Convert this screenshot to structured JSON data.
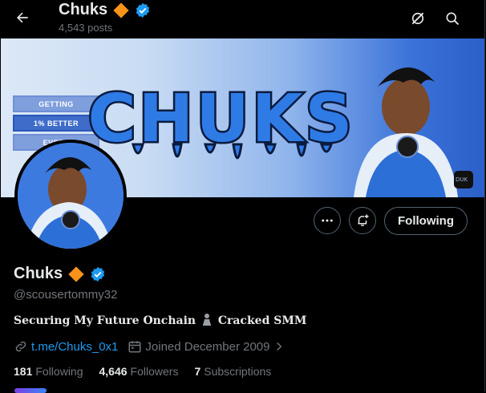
{
  "header": {
    "name": "Chuks",
    "posts_count": "4,543 posts"
  },
  "banner": {
    "pill_lines": [
      "GETTING",
      "1% BETTER",
      "EVERY"
    ],
    "headline": "CHUKS",
    "badge_text": "DUK"
  },
  "profile": {
    "name": "Chuks",
    "handle": "@scousertommy32",
    "bio_part1": "Securing My Future Onchain",
    "bio_part2": "Cracked SMM",
    "link": "t.me/Chuks_0x1",
    "joined": "Joined December 2009"
  },
  "actions": {
    "follow_label": "Following"
  },
  "stats": {
    "following_count": "181",
    "following_label": "Following",
    "followers_count": "4,646",
    "followers_label": "Followers",
    "subscriptions_count": "7",
    "subscriptions_label": "Subscriptions"
  },
  "colors": {
    "background": "#000000",
    "accent_blue": "#1d9bf0",
    "verified_orange": "#f7931a",
    "muted_text": "#71767b"
  },
  "icons": {
    "back": "arrow-left-icon",
    "grok": "grok-icon",
    "search": "search-icon",
    "more": "more-icon",
    "notify": "bell-plus-icon",
    "link": "link-icon",
    "calendar": "calendar-icon"
  }
}
